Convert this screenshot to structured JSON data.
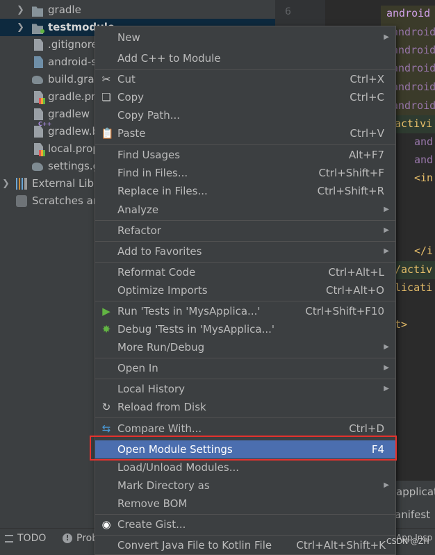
{
  "tree": {
    "items": [
      {
        "label": "gradle"
      },
      {
        "label": "testmodule"
      },
      {
        "label": ".gitignore"
      },
      {
        "label": "android-s"
      },
      {
        "label": "build.grad"
      },
      {
        "label": "gradle.pr"
      },
      {
        "label": "gradlew"
      },
      {
        "label": "gradlew.b"
      },
      {
        "label": "local.prop"
      },
      {
        "label": "settings.g"
      },
      {
        "label": "External Libra"
      },
      {
        "label": "Scratches an"
      }
    ]
  },
  "editor": {
    "line_number": "6",
    "lines": [
      "android",
      "android",
      "android",
      "android",
      "android",
      "android",
      "activi",
      "and",
      "and",
      "<in",
      "</i",
      "/activ",
      "licati",
      "t>"
    ],
    "bottom_panel": [
      "applicat",
      "anifest",
      "App Insp"
    ]
  },
  "menu": {
    "items": [
      {
        "label": "New",
        "submenu": true
      },
      {
        "label": "Add C++ to Module"
      },
      {
        "label": "Cut",
        "shortcut": "Ctrl+X",
        "icon": "scissors-icon"
      },
      {
        "label": "Copy",
        "shortcut": "Ctrl+C",
        "icon": "copy-icon"
      },
      {
        "label": "Copy Path..."
      },
      {
        "label": "Paste",
        "shortcut": "Ctrl+V",
        "icon": "paste-icon"
      },
      {
        "label": "Find Usages",
        "shortcut": "Alt+F7"
      },
      {
        "label": "Find in Files...",
        "shortcut": "Ctrl+Shift+F"
      },
      {
        "label": "Replace in Files...",
        "shortcut": "Ctrl+Shift+R"
      },
      {
        "label": "Analyze",
        "submenu": true
      },
      {
        "label": "Refactor",
        "submenu": true
      },
      {
        "label": "Add to Favorites",
        "submenu": true
      },
      {
        "label": "Reformat Code",
        "shortcut": "Ctrl+Alt+L"
      },
      {
        "label": "Optimize Imports",
        "shortcut": "Ctrl+Alt+O"
      },
      {
        "label": "Run 'Tests in 'MysApplica...'",
        "shortcut": "Ctrl+Shift+F10",
        "icon": "run-icon"
      },
      {
        "label": "Debug 'Tests in 'MysApplica...'",
        "icon": "debug-icon"
      },
      {
        "label": "More Run/Debug",
        "submenu": true
      },
      {
        "label": "Open In",
        "submenu": true
      },
      {
        "label": "Local History",
        "submenu": true
      },
      {
        "label": "Reload from Disk",
        "icon": "reload-icon"
      },
      {
        "label": "Compare With...",
        "shortcut": "Ctrl+D",
        "icon": "compare-icon"
      },
      {
        "label": "Open Module Settings",
        "shortcut": "F4",
        "highlighted": true
      },
      {
        "label": "Load/Unload Modules..."
      },
      {
        "label": "Mark Directory as",
        "submenu": true
      },
      {
        "label": "Remove BOM"
      },
      {
        "label": "Create Gist...",
        "icon": "github-icon"
      },
      {
        "label": "Convert Java File to Kotlin File",
        "shortcut": "Ctrl+Alt+Shift+K"
      }
    ]
  },
  "status": {
    "todo": "TODO",
    "problems": "Prob"
  },
  "watermark": "CSDN @ZH",
  "colors": {
    "menu_bg": "#3c3f41",
    "highlight": "#4b6eaf",
    "red_box": "#e5322d",
    "run_green": "#62b543"
  }
}
